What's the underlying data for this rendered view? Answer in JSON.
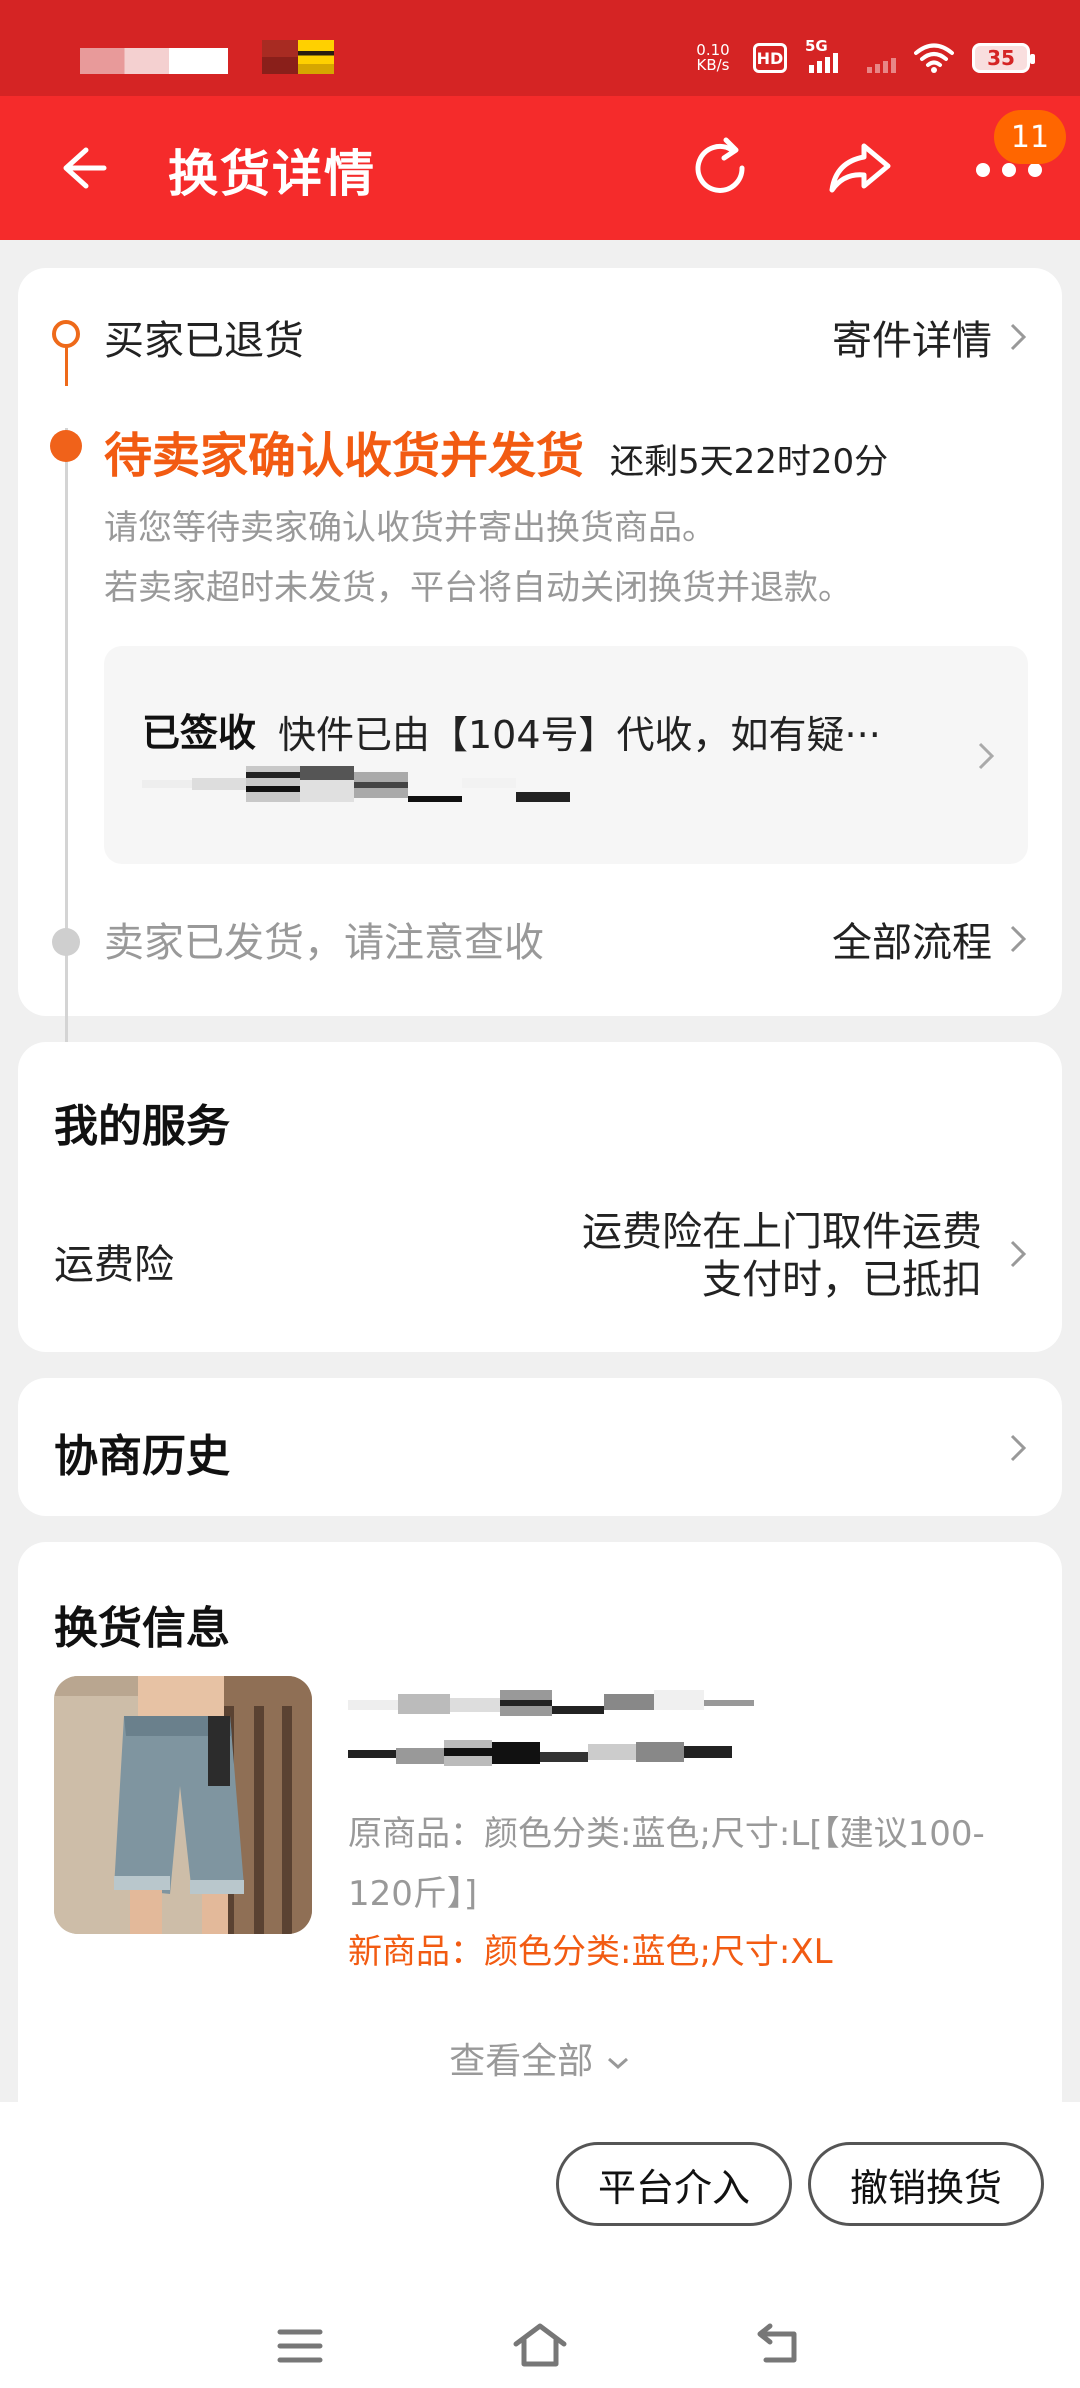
{
  "status_bar": {
    "net_speed_value": "0.10",
    "net_speed_unit": "KB/s",
    "hd": "HD",
    "network": "5G",
    "battery": "35"
  },
  "header": {
    "title": "换货详情",
    "back_icon": "arrow-left-icon",
    "refresh_icon": "refresh-icon",
    "share_icon": "share-icon",
    "more_icon": "more-dots-icon",
    "badge_count": "11"
  },
  "status_card": {
    "step1": "买家已退货",
    "ship_detail_link": "寄件详情",
    "step2": "待卖家确认收货并发货",
    "countdown": "还剩5天22时20分",
    "desc1": "请您等待卖家确认收货并寄出换货商品。",
    "desc2": "若卖家超时未发货，平台将自动关闭换货并退款。",
    "logistics": {
      "status": "已签收",
      "text": "快件已由【104号】代收，如有疑···"
    },
    "step3": "卖家已发货，请注意查收",
    "all_flow_link": "全部流程"
  },
  "service_card": {
    "title": "我的服务",
    "name": "运费险",
    "value_line1": "运费险在上门取件运费",
    "value_line2": "支付时，已抵扣"
  },
  "history_card": {
    "title": "协商历史"
  },
  "exchange_card": {
    "title": "换货信息",
    "original": "原商品：颜色分类:蓝色;尺寸:L[【建议100-120斤】]",
    "new": "新商品：颜色分类:蓝色;尺寸:XL",
    "view_all": "查看全部"
  },
  "actions": {
    "platform": "平台介入",
    "cancel": "撤销换货"
  },
  "colors": {
    "status_bar": "#d52424",
    "header": "#f52b2b",
    "accent_orange": "#f25b12",
    "badge": "#ff6600"
  }
}
